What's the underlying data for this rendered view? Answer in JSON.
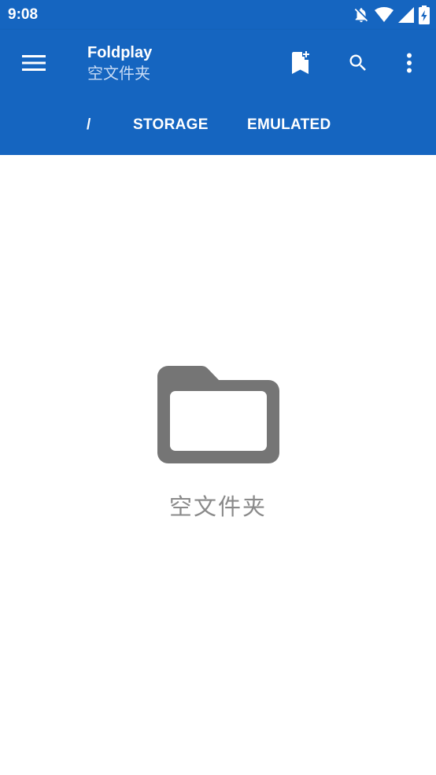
{
  "status_bar": {
    "time": "9:08",
    "icons": [
      "notifications-off-icon",
      "wifi-icon",
      "signal-icon",
      "battery-charging-icon"
    ]
  },
  "app_bar": {
    "title": "Foldplay",
    "subtitle": "空文件夹",
    "actions": [
      "bookmark-add-icon",
      "search-icon",
      "more-vert-icon"
    ],
    "color": "#1565c0"
  },
  "breadcrumb": {
    "items": [
      "/",
      "STORAGE",
      "EMULATED"
    ]
  },
  "content": {
    "empty_icon": "folder-icon",
    "empty_message": "空文件夹"
  }
}
